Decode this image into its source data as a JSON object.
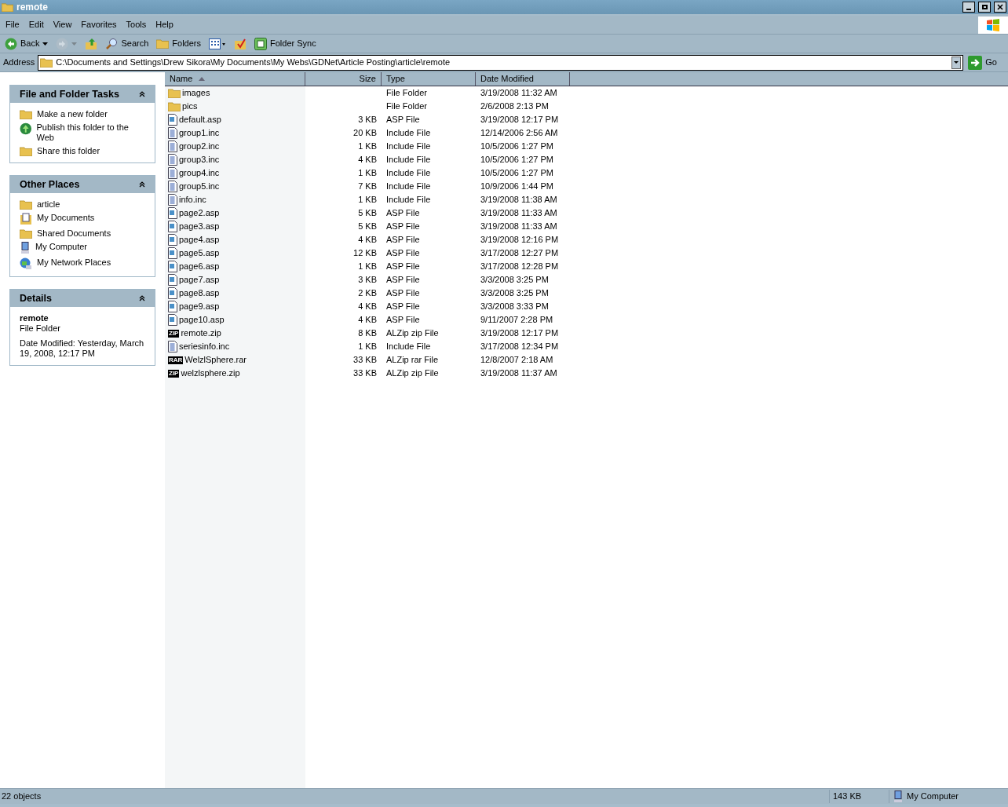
{
  "window": {
    "title": "remote"
  },
  "menu": [
    "File",
    "Edit",
    "View",
    "Favorites",
    "Tools",
    "Help"
  ],
  "toolbar": [
    {
      "kind": "back",
      "label": "Back",
      "disabled": false
    },
    {
      "kind": "forward",
      "disabled": true
    },
    {
      "kind": "up",
      "disabled": false
    },
    {
      "kind": "search",
      "label": "Search",
      "disabled": false
    },
    {
      "kind": "folders",
      "label": "Folders",
      "disabled": false
    },
    {
      "kind": "views",
      "disabled": false
    },
    {
      "kind": "check",
      "disabled": false
    },
    {
      "kind": "sync",
      "label": "Folder Sync",
      "disabled": false
    }
  ],
  "address": {
    "label": "Address",
    "value": "C:\\Documents and Settings\\Drew Sikora\\My Documents\\My Webs\\GDNet\\Article Posting\\article\\remote",
    "go": "Go"
  },
  "sidebar": [
    {
      "title": "File and Folder Tasks",
      "expanded": true,
      "kind": "links",
      "items": [
        {
          "kind": "newfolder",
          "label": "Make a new folder"
        },
        {
          "kind": "globe",
          "label": "Publish this folder to the Web"
        },
        {
          "kind": "share",
          "label": "Share this folder"
        }
      ]
    },
    {
      "title": "Other Places",
      "expanded": true,
      "kind": "links",
      "items": [
        {
          "kind": "folder",
          "label": "article"
        },
        {
          "kind": "docs",
          "label": "My Documents"
        },
        {
          "kind": "folder",
          "label": "Shared Documents"
        },
        {
          "kind": "computer",
          "label": "My Computer"
        },
        {
          "kind": "network",
          "label": "My Network Places"
        }
      ]
    },
    {
      "title": "Details",
      "expanded": true,
      "kind": "details",
      "name": "remote",
      "type": "File Folder",
      "modified": "Date Modified: Yesterday, March 19, 2008, 12:17 PM"
    }
  ],
  "table": {
    "columns": [
      {
        "label": "Name",
        "sorted": true
      },
      {
        "label": "Size",
        "sorted": false
      },
      {
        "label": "Type",
        "sorted": false
      },
      {
        "label": "Date Modified",
        "sorted": false
      }
    ],
    "rows": [
      {
        "kind": "folder",
        "name": "images",
        "size": "",
        "type": "File Folder",
        "date": "3/19/2008 11:32 AM"
      },
      {
        "kind": "folder",
        "name": "pics",
        "size": "",
        "type": "File Folder",
        "date": "2/6/2008 2:13 PM"
      },
      {
        "kind": "asp",
        "name": "default.asp",
        "size": "3 KB",
        "type": "ASP File",
        "date": "3/19/2008 12:17 PM"
      },
      {
        "kind": "inc",
        "name": "group1.inc",
        "size": "20 KB",
        "type": "Include File",
        "date": "12/14/2006 2:56 AM"
      },
      {
        "kind": "inc",
        "name": "group2.inc",
        "size": "1 KB",
        "type": "Include File",
        "date": "10/5/2006 1:27 PM"
      },
      {
        "kind": "inc",
        "name": "group3.inc",
        "size": "4 KB",
        "type": "Include File",
        "date": "10/5/2006 1:27 PM"
      },
      {
        "kind": "inc",
        "name": "group4.inc",
        "size": "1 KB",
        "type": "Include File",
        "date": "10/5/2006 1:27 PM"
      },
      {
        "kind": "inc",
        "name": "group5.inc",
        "size": "7 KB",
        "type": "Include File",
        "date": "10/9/2006 1:44 PM"
      },
      {
        "kind": "inc",
        "name": "info.inc",
        "size": "1 KB",
        "type": "Include File",
        "date": "3/19/2008 11:38 AM"
      },
      {
        "kind": "asp",
        "name": "page2.asp",
        "size": "5 KB",
        "type": "ASP File",
        "date": "3/19/2008 11:33 AM"
      },
      {
        "kind": "asp",
        "name": "page3.asp",
        "size": "5 KB",
        "type": "ASP File",
        "date": "3/19/2008 11:33 AM"
      },
      {
        "kind": "asp",
        "name": "page4.asp",
        "size": "4 KB",
        "type": "ASP File",
        "date": "3/19/2008 12:16 PM"
      },
      {
        "kind": "asp",
        "name": "page5.asp",
        "size": "12 KB",
        "type": "ASP File",
        "date": "3/17/2008 12:27 PM"
      },
      {
        "kind": "asp",
        "name": "page6.asp",
        "size": "1 KB",
        "type": "ASP File",
        "date": "3/17/2008 12:28 PM"
      },
      {
        "kind": "asp",
        "name": "page7.asp",
        "size": "3 KB",
        "type": "ASP File",
        "date": "3/3/2008 3:25 PM"
      },
      {
        "kind": "asp",
        "name": "page8.asp",
        "size": "2 KB",
        "type": "ASP File",
        "date": "3/3/2008 3:25 PM"
      },
      {
        "kind": "asp",
        "name": "page9.asp",
        "size": "4 KB",
        "type": "ASP File",
        "date": "3/3/2008 3:33 PM"
      },
      {
        "kind": "asp",
        "name": "page10.asp",
        "size": "4 KB",
        "type": "ASP File",
        "date": "9/11/2007 2:28 PM"
      },
      {
        "kind": "archive",
        "badge": "ZIP",
        "name": "remote.zip",
        "size": "8 KB",
        "type": "ALZip zip File",
        "date": "3/19/2008 12:17 PM"
      },
      {
        "kind": "inc",
        "name": "seriesinfo.inc",
        "size": "1 KB",
        "type": "Include File",
        "date": "3/17/2008 12:34 PM"
      },
      {
        "kind": "archive",
        "badge": "RAR",
        "name": "WelzlSphere.rar",
        "size": "33 KB",
        "type": "ALZip rar File",
        "date": "12/8/2007 2:18 AM"
      },
      {
        "kind": "archive",
        "badge": "ZIP",
        "name": "welzlsphere.zip",
        "size": "33 KB",
        "type": "ALZip zip File",
        "date": "3/19/2008 11:37 AM"
      }
    ]
  },
  "status_bar": {
    "objects": "22 objects",
    "size": "143 KB",
    "zone": "My Computer"
  }
}
